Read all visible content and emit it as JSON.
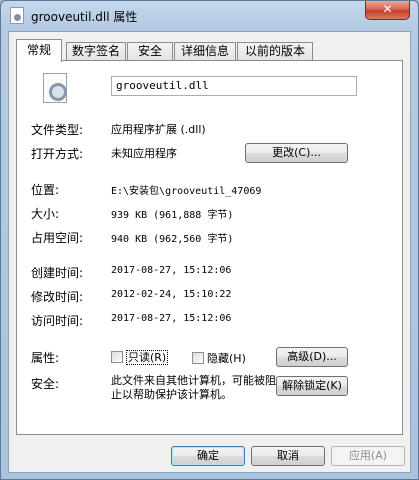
{
  "window": {
    "title": "grooveutil.dll 属性",
    "close_label": "✕"
  },
  "tabs": [
    {
      "label": "常规",
      "active": true
    },
    {
      "label": "数字签名"
    },
    {
      "label": "安全"
    },
    {
      "label": "详细信息"
    },
    {
      "label": "以前的版本"
    }
  ],
  "general": {
    "file_name": "grooveutil.dll",
    "file_type_label": "文件类型:",
    "file_type_value": "应用程序扩展 (.dll)",
    "opens_with_label": "打开方式:",
    "opens_with_value": "未知应用程序",
    "change_button": "更改(C)...",
    "location_label": "位置:",
    "location_value": "E:\\安装包\\grooveutil_47069",
    "size_label": "大小:",
    "size_value": "939 KB (961,888 字节)",
    "size_on_disk_label": "占用空间:",
    "size_on_disk_value": "940 KB (962,560 字节)",
    "created_label": "创建时间:",
    "created_value": "2017-08-27, 15:12:06",
    "modified_label": "修改时间:",
    "modified_value": "2012-02-24, 15:10:22",
    "accessed_label": "访问时间:",
    "accessed_value": "2017-08-27, 15:12:06",
    "attributes_label": "属性:",
    "readonly_label": "只读(R)",
    "hidden_label": "隐藏(H)",
    "advanced_button": "高级(D)...",
    "security_label": "安全:",
    "security_note": "此文件来自其他计算机，可能被阻止以帮助保护该计算机。",
    "unblock_button": "解除锁定(K)"
  },
  "footer": {
    "ok_button": "确定",
    "cancel_button": "取消",
    "apply_button": "应用(A)"
  }
}
